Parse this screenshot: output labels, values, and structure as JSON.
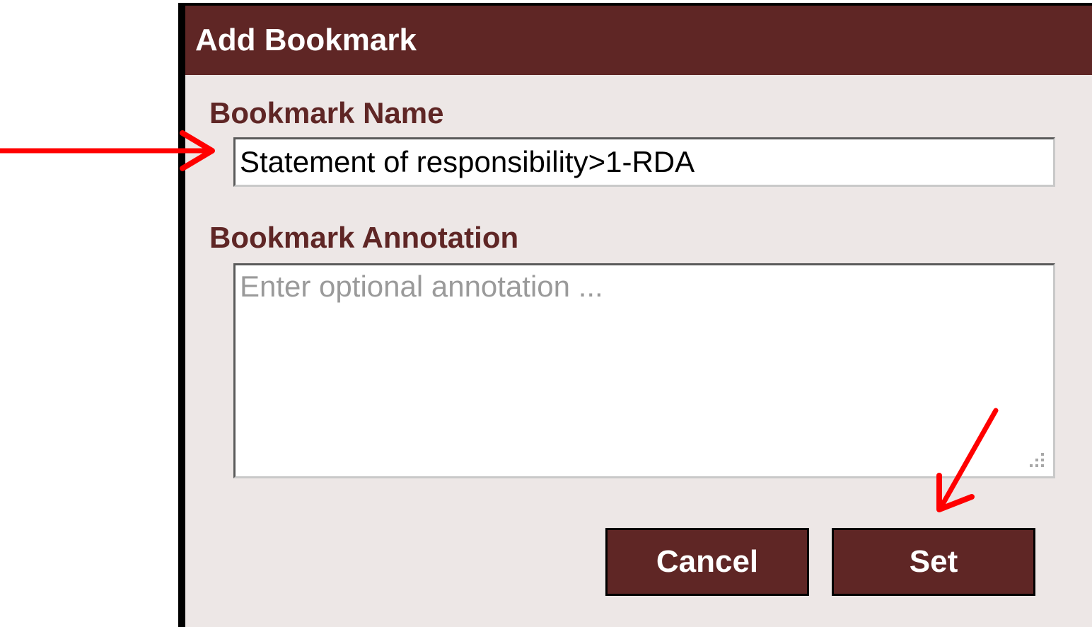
{
  "dialog": {
    "title": "Add Bookmark",
    "name_label": "Bookmark Name",
    "name_value": "Statement of responsibility>1-RDA",
    "annotation_label": "Bookmark Annotation",
    "annotation_placeholder": "Enter optional annotation ...",
    "annotation_value": "",
    "cancel_label": "Cancel",
    "set_label": "Set"
  },
  "colors": {
    "titlebar": "#5f2625",
    "dialog_background": "#ede7e6",
    "label_text": "#5f2625",
    "button_background": "#5f2625",
    "annotation_arrows": "#ff0000"
  },
  "icons": {
    "resize_grip": "resize-grip-icon",
    "arrows": "red-arrow-icon"
  }
}
